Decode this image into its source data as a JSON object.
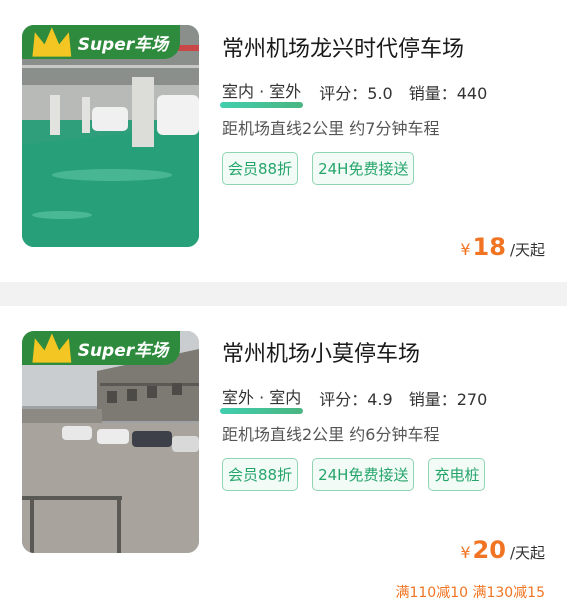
{
  "listings": [
    {
      "badge": "Super车场",
      "title": "常州机场龙兴时代停车场",
      "location_type": "室内 · 室外",
      "rating_label": "评分：5.0",
      "sales_label": "销量：440",
      "distance": "距机场直线2公里 约7分钟车程",
      "tags": [
        "会员88折",
        "24H免费接送"
      ],
      "price_currency": "¥",
      "price_amount": "18",
      "price_unit": "/天起",
      "promo": ""
    },
    {
      "badge": "Super车场",
      "title": "常州机场小莫停车场",
      "location_type": "室外 · 室内",
      "rating_label": "评分：4.9",
      "sales_label": "销量：270",
      "distance": "距机场直线2公里 约6分钟车程",
      "tags": [
        "会员88折",
        "24H免费接送",
        "充电桩"
      ],
      "price_currency": "¥",
      "price_amount": "20",
      "price_unit": "/天起",
      "promo": "满110减10 满130减15"
    }
  ],
  "colors": {
    "accent_green": "#26a56b",
    "badge_green": "#2e8b3e",
    "price_orange": "#f07422",
    "crown_gold": "#f3c623"
  },
  "icons": {
    "crown": "crown-icon"
  }
}
